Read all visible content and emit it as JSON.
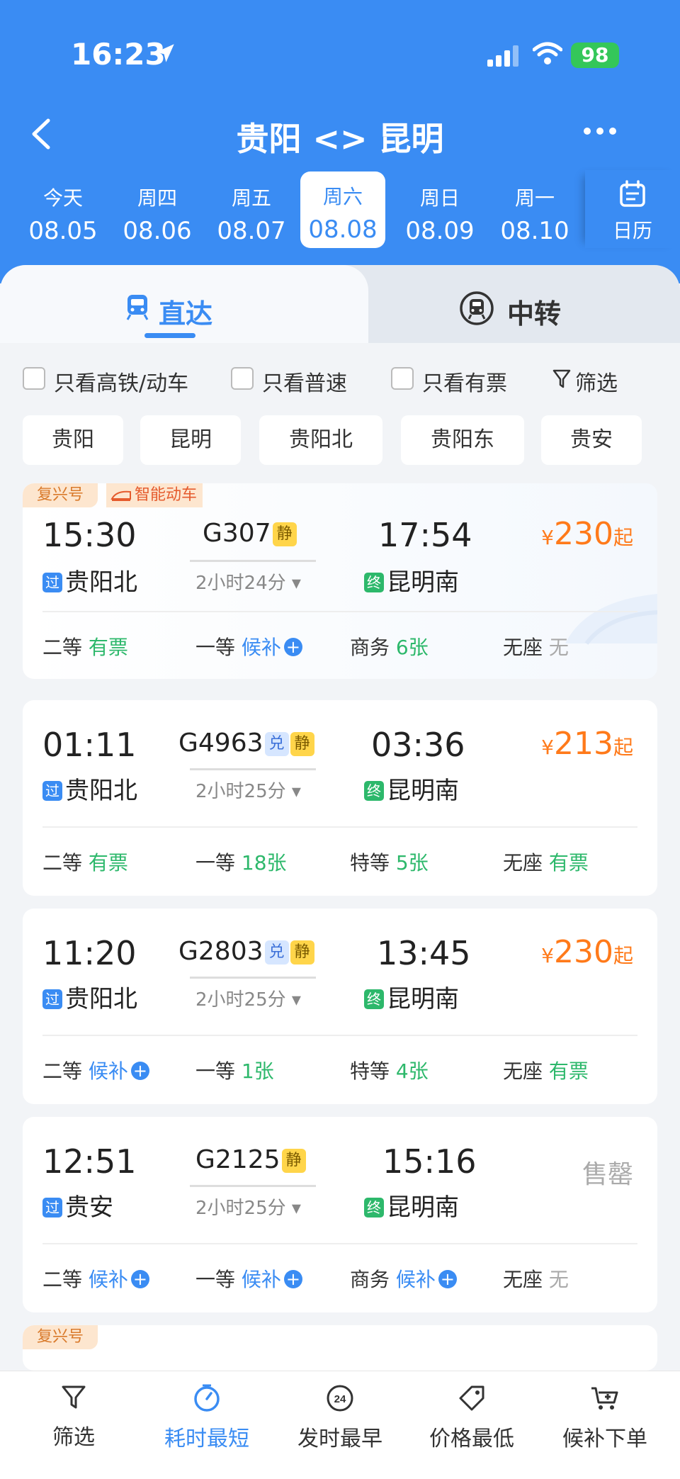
{
  "status": {
    "time": "16:23",
    "battery": "98"
  },
  "nav": {
    "title": "贵阳 <> 昆明"
  },
  "dates": [
    {
      "day": "今天",
      "date": "08.05",
      "selected": false
    },
    {
      "day": "周四",
      "date": "08.06",
      "selected": false
    },
    {
      "day": "周五",
      "date": "08.07",
      "selected": false
    },
    {
      "day": "周六",
      "date": "08.08",
      "selected": true
    },
    {
      "day": "周日",
      "date": "08.09",
      "selected": false
    },
    {
      "day": "周一",
      "date": "08.10",
      "selected": false
    }
  ],
  "calendar_label": "日历",
  "tabs": {
    "direct": "直达",
    "transfer": "中转"
  },
  "filters": {
    "highspeed": "只看高铁/动车",
    "normal": "只看普速",
    "available": "只看有票",
    "filter": "筛选"
  },
  "stations": [
    "贵阳",
    "昆明",
    "贵阳北",
    "贵阳东",
    "贵安"
  ],
  "trains": [
    {
      "tag1": "复兴号",
      "tag2": "智能动车",
      "dep_time": "15:30",
      "dep_station": "贵阳北",
      "dep_badge": "过",
      "train_no": "G307",
      "duration": "2小时24分",
      "arr_time": "17:54",
      "arr_station": "昆明南",
      "arr_badge": "终",
      "price": "230",
      "price_prefix": "¥",
      "price_suffix": "起",
      "seats": [
        {
          "name": "二等",
          "status": "有票"
        },
        {
          "name": "一等",
          "status": "候补"
        },
        {
          "name": "商务",
          "status": "6张"
        },
        {
          "name": "无座",
          "status": "无"
        }
      ]
    },
    {
      "dep_time": "01:11",
      "dep_station": "贵阳北",
      "dep_badge": "过",
      "train_no": "G4963",
      "duration": "2小时25分",
      "arr_time": "03:36",
      "arr_station": "昆明南",
      "arr_badge": "终",
      "price": "213",
      "price_prefix": "¥",
      "price_suffix": "起",
      "seats": [
        {
          "name": "二等",
          "status": "有票"
        },
        {
          "name": "一等",
          "status": "18张"
        },
        {
          "name": "特等",
          "status": "5张"
        },
        {
          "name": "无座",
          "status": "有票"
        }
      ]
    },
    {
      "dep_time": "11:20",
      "dep_station": "贵阳北",
      "dep_badge": "过",
      "train_no": "G2803",
      "duration": "2小时25分",
      "arr_time": "13:45",
      "arr_station": "昆明南",
      "arr_badge": "终",
      "price": "230",
      "price_prefix": "¥",
      "price_suffix": "起",
      "seats": [
        {
          "name": "二等",
          "status": "候补"
        },
        {
          "name": "一等",
          "status": "1张"
        },
        {
          "name": "特等",
          "status": "4张"
        },
        {
          "name": "无座",
          "status": "有票"
        }
      ]
    },
    {
      "dep_time": "12:51",
      "dep_station": "贵安",
      "dep_badge": "过",
      "train_no": "G2125",
      "duration": "2小时25分",
      "arr_time": "15:16",
      "arr_station": "昆明南",
      "arr_badge": "终",
      "price_text": "售罄",
      "seats": [
        {
          "name": "二等",
          "status": "候补"
        },
        {
          "name": "一等",
          "status": "候补"
        },
        {
          "name": "商务",
          "status": "候补"
        },
        {
          "name": "无座",
          "status": "无"
        }
      ]
    },
    {
      "tag1": "复兴号"
    }
  ],
  "badges": {
    "jing": "静",
    "dui": "兑"
  },
  "bottom": {
    "filter": "筛选",
    "shortest": "耗时最短",
    "earliest": "发时最早",
    "cheapest": "价格最低",
    "waitlist": "候补下单"
  },
  "colors": {
    "primary": "#3a8cf3",
    "price": "#ff7a1a",
    "available": "#2db86b"
  }
}
